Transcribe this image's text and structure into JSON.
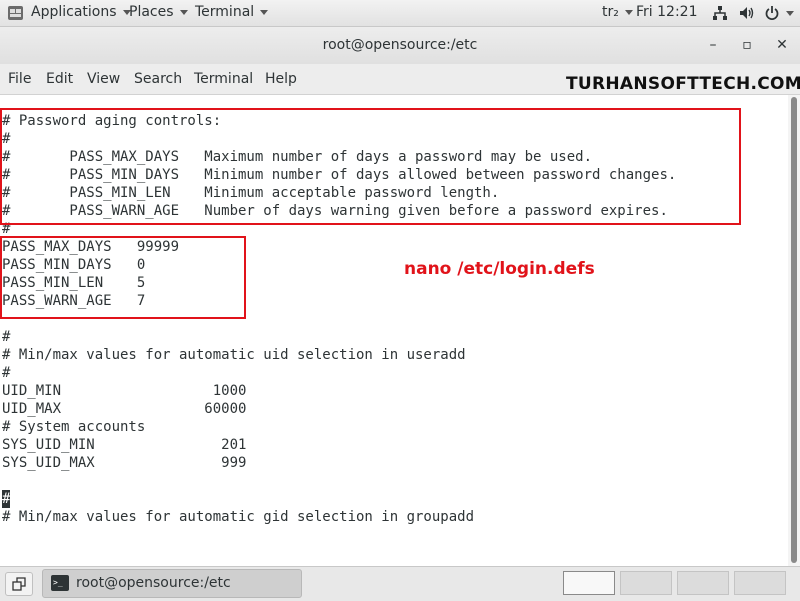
{
  "topbar": {
    "applications": "Applications",
    "places": "Places",
    "terminal": "Terminal",
    "keyboard_layout": "tr₂",
    "clock": "Fri 12:21"
  },
  "window": {
    "title": "root@opensource:/etc",
    "minimize": "–",
    "maximize": "▫",
    "close": "✕"
  },
  "menubar": [
    "File",
    "Edit",
    "View",
    "Search",
    "Terminal",
    "Help"
  ],
  "watermark": "TURHANSOFTTECH.COM",
  "annotation": "nano /etc/login.defs",
  "terminal_lines": [
    "# Password aging controls:",
    "#",
    "#       PASS_MAX_DAYS   Maximum number of days a password may be used.",
    "#       PASS_MIN_DAYS   Minimum number of days allowed between password changes.",
    "#       PASS_MIN_LEN    Minimum acceptable password length.",
    "#       PASS_WARN_AGE   Number of days warning given before a password expires.",
    "#",
    "PASS_MAX_DAYS   99999",
    "PASS_MIN_DAYS   0",
    "PASS_MIN_LEN    5",
    "PASS_WARN_AGE   7",
    "",
    "#",
    "# Min/max values for automatic uid selection in useradd",
    "#",
    "UID_MIN                  1000",
    "UID_MAX                 60000",
    "# System accounts",
    "SYS_UID_MIN               201",
    "SYS_UID_MAX               999",
    "",
    "#",
    "# Min/max values for automatic gid selection in groupadd"
  ],
  "taskbar": {
    "task_label": "root@opensource:/etc",
    "task_icon_text": ">_"
  },
  "colors": {
    "highlight_red": "#e1131a",
    "terminal_fg": "#2e3436",
    "terminal_bg": "#ffffff"
  }
}
